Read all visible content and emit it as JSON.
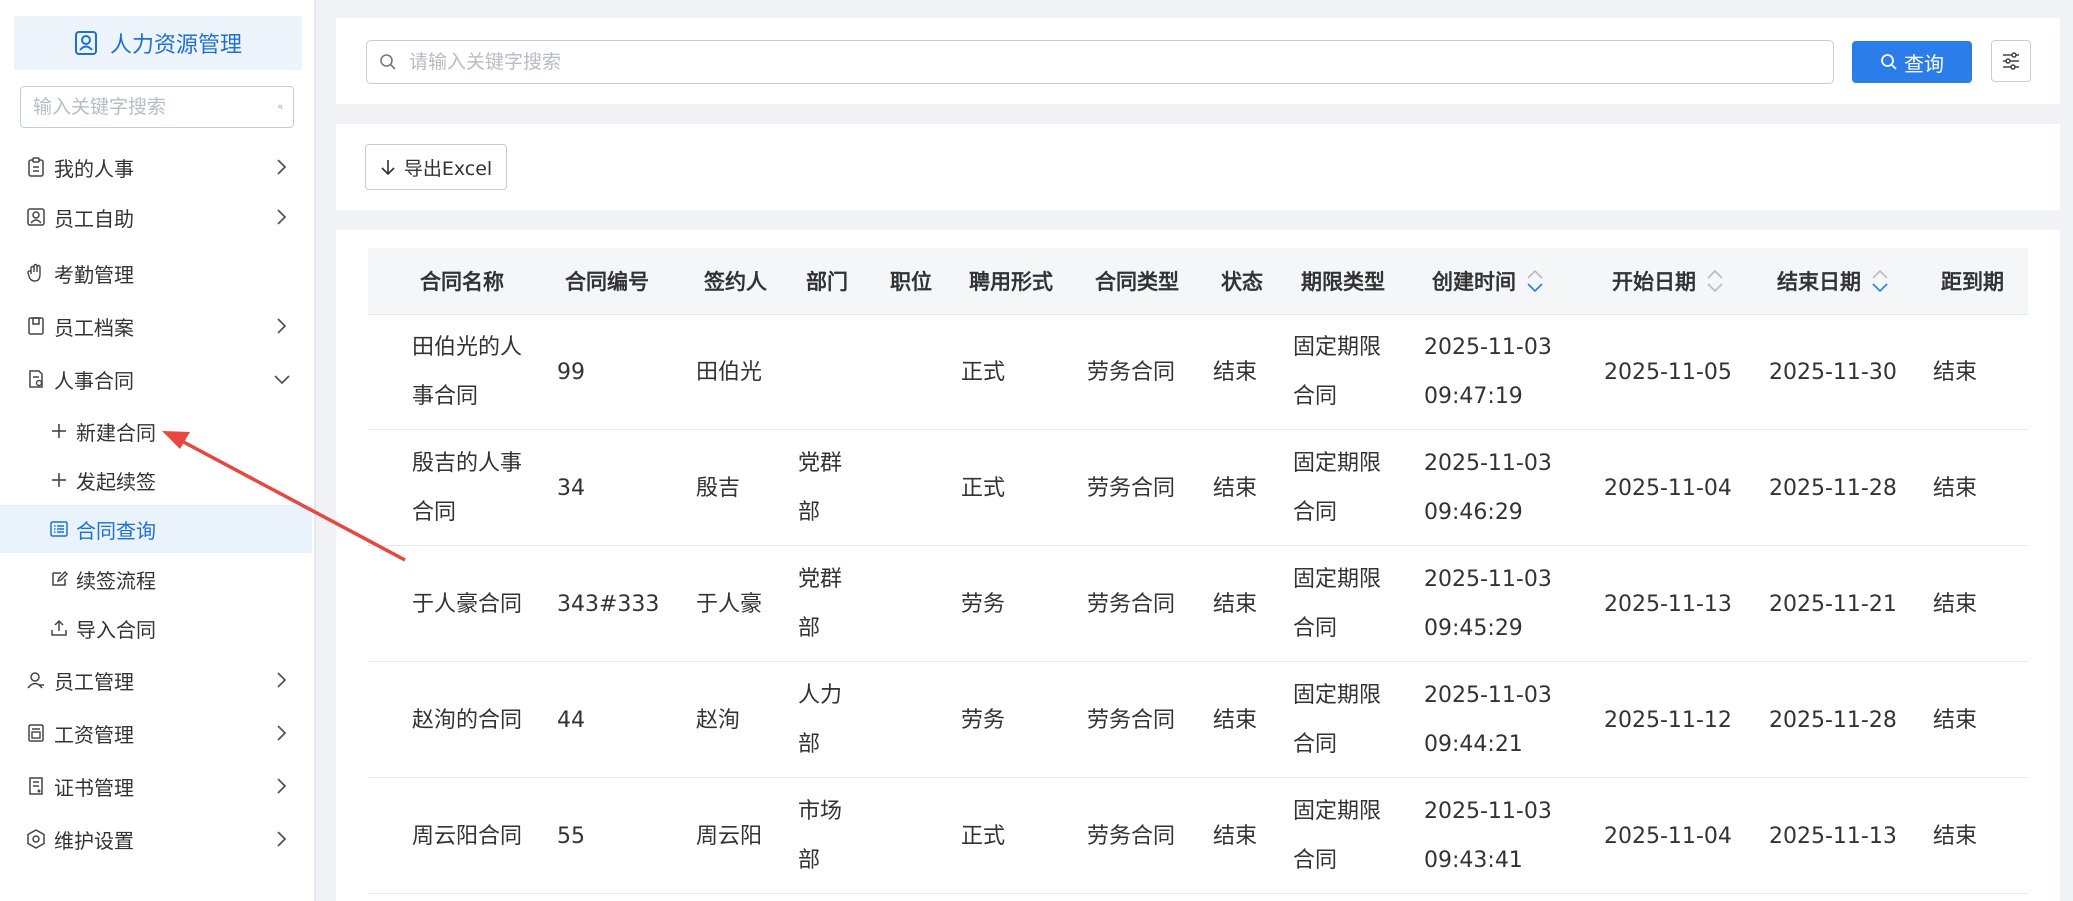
{
  "app": {
    "title": "人力资源管理"
  },
  "sidebar": {
    "search_placeholder": "输入关键字搜索",
    "menu": [
      {
        "label": "我的人事",
        "icon": "clipboard-icon",
        "expanded": false
      },
      {
        "label": "员工自助",
        "icon": "person-card-icon",
        "expanded": false
      },
      {
        "label": "考勤管理",
        "icon": "hand-icon",
        "expanded": false
      },
      {
        "label": "员工档案",
        "icon": "archive-icon",
        "expanded": false
      },
      {
        "label": "人事合同",
        "icon": "contract-icon",
        "expanded": true
      },
      {
        "label": "员工管理",
        "icon": "user-icon",
        "expanded": false
      },
      {
        "label": "工资管理",
        "icon": "salary-icon",
        "expanded": false
      },
      {
        "label": "证书管理",
        "icon": "certificate-icon",
        "expanded": false
      },
      {
        "label": "维护设置",
        "icon": "settings-icon",
        "expanded": false
      }
    ],
    "submenu": [
      {
        "label": "新建合同",
        "icon": "plus-icon",
        "active": false
      },
      {
        "label": "发起续签",
        "icon": "plus-icon",
        "active": false
      },
      {
        "label": "合同查询",
        "icon": "list-icon",
        "active": true
      },
      {
        "label": "续签流程",
        "icon": "edit-icon",
        "active": false
      },
      {
        "label": "导入合同",
        "icon": "upload-icon",
        "active": false
      }
    ]
  },
  "search": {
    "placeholder": "请输入关键字搜索",
    "query_label": "查询"
  },
  "toolbar": {
    "export_label": "导出Excel"
  },
  "table": {
    "columns": [
      "合同名称",
      "合同编号",
      "签约人",
      "部门",
      "职位",
      "聘用形式",
      "合同类型",
      "状态",
      "期限类型",
      "创建时间",
      "开始日期",
      "结束日期",
      "距到期"
    ],
    "rows": [
      {
        "name": "田伯光的人事合同",
        "number": "99",
        "signer": "田伯光",
        "dept": "",
        "position": "",
        "employment": "正式",
        "type": "劳务合同",
        "status": "结束",
        "term": "固定期限合同",
        "created": "2025-11-03 09:47:19",
        "start": "2025-11-05",
        "end": "2025-11-30",
        "expiry": "结束"
      },
      {
        "name": "殷吉的人事合同",
        "number": "34",
        "signer": "殷吉",
        "dept": "党群部",
        "position": "",
        "employment": "正式",
        "type": "劳务合同",
        "status": "结束",
        "term": "固定期限合同",
        "created": "2025-11-03 09:46:29",
        "start": "2025-11-04",
        "end": "2025-11-28",
        "expiry": "结束"
      },
      {
        "name": "于人豪合同",
        "number": "343#333",
        "signer": "于人豪",
        "dept": "党群部",
        "position": "",
        "employment": "劳务",
        "type": "劳务合同",
        "status": "结束",
        "term": "固定期限合同",
        "created": "2025-11-03 09:45:29",
        "start": "2025-11-13",
        "end": "2025-11-21",
        "expiry": "结束"
      },
      {
        "name": "赵洵的合同",
        "number": "44",
        "signer": "赵洵",
        "dept": "人力部",
        "position": "",
        "employment": "劳务",
        "type": "劳务合同",
        "status": "结束",
        "term": "固定期限合同",
        "created": "2025-11-03 09:44:21",
        "start": "2025-11-12",
        "end": "2025-11-28",
        "expiry": "结束"
      },
      {
        "name": "周云阳合同",
        "number": "55",
        "signer": "周云阳",
        "dept": "市场部",
        "position": "",
        "employment": "正式",
        "type": "劳务合同",
        "status": "结束",
        "term": "固定期限合同",
        "created": "2025-11-03 09:43:41",
        "start": "2025-11-04",
        "end": "2025-11-13",
        "expiry": "结束"
      }
    ]
  },
  "colors": {
    "accent": "#2b7de9",
    "active_bg": "#eaf2fc",
    "annotation": "#e8463f"
  }
}
